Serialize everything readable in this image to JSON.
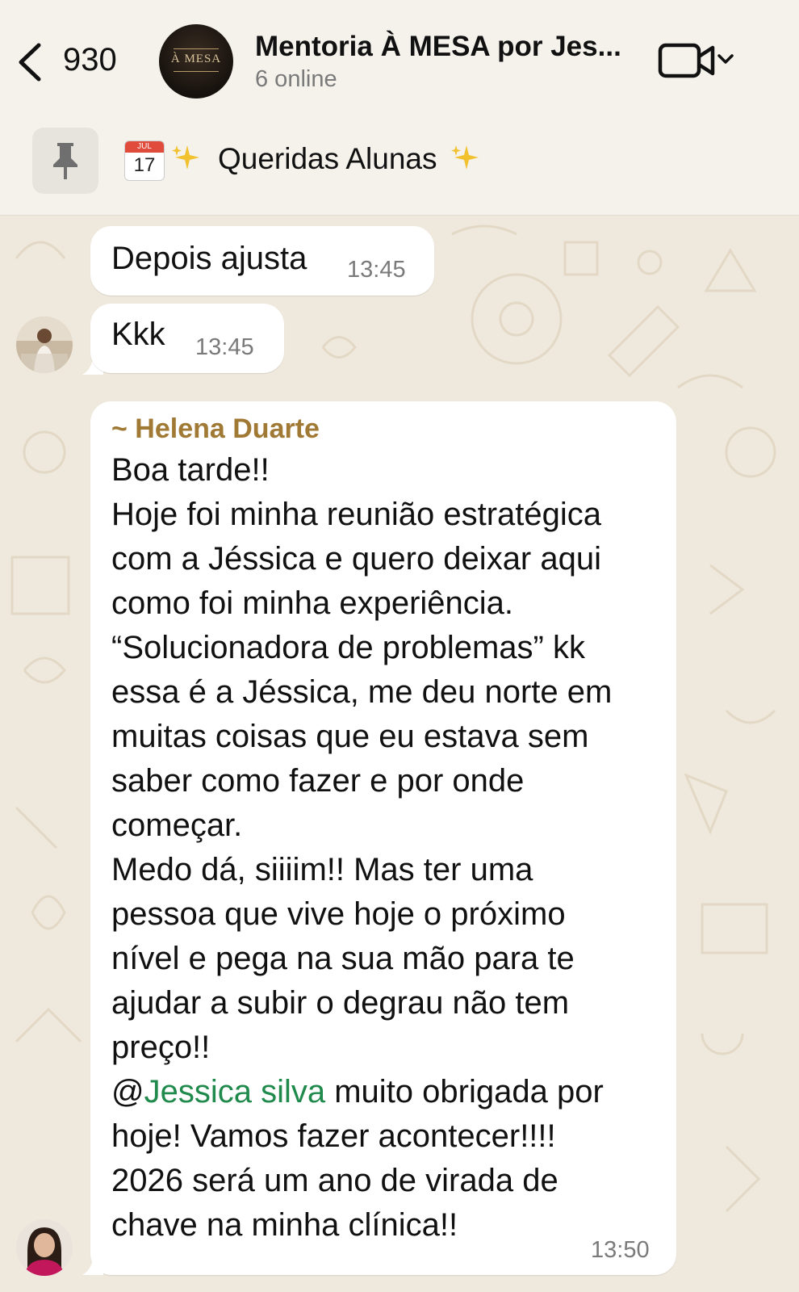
{
  "header": {
    "back_count": "930",
    "group_title": "Mentoria À MESA por Jes...",
    "group_subtitle": "6 online",
    "avatar_text": "À MESA"
  },
  "pinned": {
    "calendar_month": "JUL",
    "calendar_day": "17",
    "text": "Queridas Alunas"
  },
  "messages": [
    {
      "text": "Depois ajusta",
      "time": "13:45"
    },
    {
      "text": "Kkk",
      "time": "13:45"
    },
    {
      "sender": "~ Helena Duarte",
      "text_before_mention": "Boa tarde!!\nHoje foi minha reunião estratégica\ncom a Jéssica e quero deixar aqui\ncomo foi minha experiência.\n“Solucionadora de problemas” kk\nessa é a Jéssica, me deu norte em\nmuitas coisas que eu estava sem\nsaber como fazer e por onde\ncomeçar.\nMedo dá, siiiim!! Mas ter uma\npessoa que vive hoje o próximo\nnível e pega na sua mão para te\najudar a subir o degrau não tem\npreço!!\n",
      "mention_at": "@",
      "mention_name": "Jessica silva",
      "text_after_mention": " muito obrigada por\nhoje! Vamos fazer acontecer!!!!\n2026 será um ano de virada de\nchave na minha clínica!!",
      "time": "13:50"
    }
  ]
}
